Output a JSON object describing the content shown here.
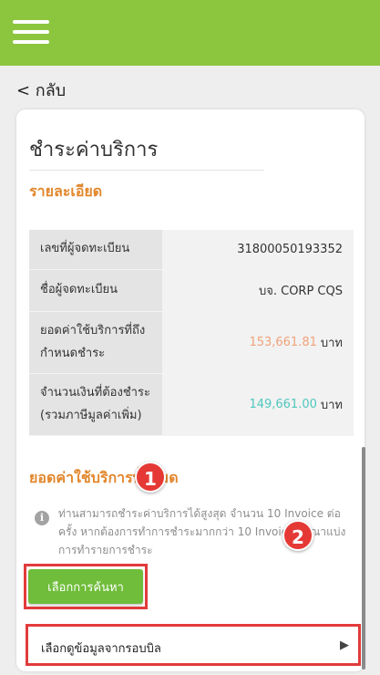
{
  "header": {
    "menu_icon": "hamburger-menu-icon"
  },
  "nav": {
    "back_label": "< กลับ"
  },
  "page": {
    "title": "ชำระค่าบริการ",
    "details_heading": "รายละเอียด",
    "details": [
      {
        "label": "เลขที่ผู้จดทะเบียน",
        "value": "31800050193352"
      },
      {
        "label": "ชื่อผู้จดทะเบียน",
        "value": "บจ. CORP CQS"
      },
      {
        "label": "ยอดค่าใช้บริการที่ถึงกำหนดชำระ",
        "amount": "153,661.81",
        "unit": "บาท",
        "amount_color": "#f0a37a"
      },
      {
        "label": "จำนวนเงินที่ต้องชำระ (รวมภาษีมูลค่าเพิ่ม)",
        "amount": "149,661.00",
        "unit": "บาท",
        "amount_color": "#4fc8bd"
      }
    ],
    "total_heading": "ยอดค่าใช้บริการทั้งหมด",
    "info_icon": "info-icon",
    "info_text": "ท่านสามารถชำระค่าบริการได้สูงสุด จำนวน 10 Invoice ต่อครั้ง หากต้องการทำการชำระมากกว่า 10 Invoice กรุณาแบ่งการทำรายการชำระ",
    "search_button": "เลือกการค้นหา",
    "bill_option": "เลือกดูข้อมูลจากรอบบิล",
    "bill_chevron_icon": "chevron-right-icon"
  },
  "annotations": {
    "marker_1": "1",
    "marker_2": "2"
  },
  "colors": {
    "topbar": "#8cc63e",
    "accent_orange": "#e2872d",
    "button_green": "#6fbd3a",
    "highlight_red": "#e23b3b"
  }
}
